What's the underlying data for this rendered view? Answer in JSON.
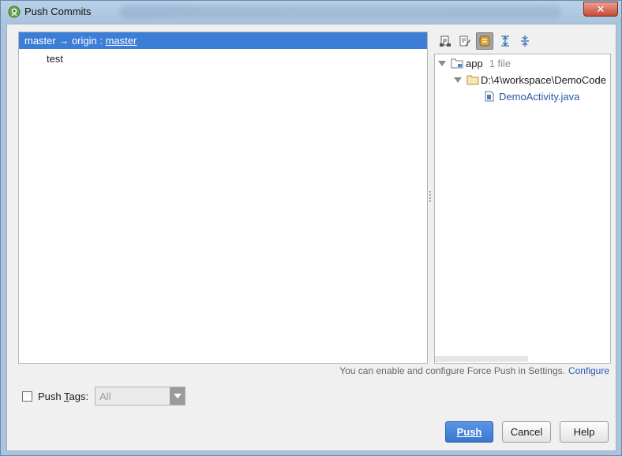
{
  "window": {
    "title": "Push Commits",
    "close_glyph": "✕"
  },
  "commits": {
    "branch_text": "master → origin : ",
    "target_branch": "master",
    "items": [
      {
        "label": "test"
      }
    ]
  },
  "changes_tree": {
    "module": {
      "name": "app",
      "count": "1 file"
    },
    "directory": {
      "path": "D:\\4\\workspace\\DemoCode"
    },
    "file": {
      "name": "DemoActivity.java"
    }
  },
  "toolbar": {
    "icons": [
      "show-diff-icon",
      "edit-source-icon",
      "group-by-directory-icon",
      "expand-all-icon",
      "collapse-all-icon"
    ],
    "active_icon": "group-by-directory-icon"
  },
  "info": {
    "text": "You can enable and configure Force Push in Settings.",
    "link": "Configure"
  },
  "push_tags": {
    "label_prefix": "Push ",
    "label_mnemonic": "T",
    "label_suffix": "ags:",
    "checked": false,
    "selected": "All"
  },
  "buttons": {
    "push": "Push",
    "cancel": "Cancel",
    "help": "Help"
  },
  "colors": {
    "selection": "#3c7dd8",
    "link": "#2a58b5",
    "file_link": "#2b54a8"
  }
}
